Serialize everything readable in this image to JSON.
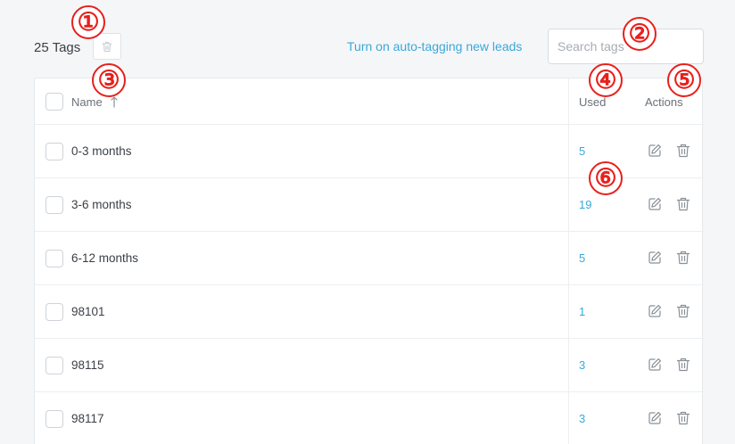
{
  "toolbar": {
    "tag_count": "25 Tags",
    "autotag_link": "Turn on auto-tagging new leads",
    "search_placeholder": "Search tags"
  },
  "table": {
    "headers": {
      "name": "Name",
      "used": "Used",
      "actions": "Actions"
    },
    "sort": {
      "column": "name",
      "direction": "ascending"
    },
    "rows": [
      {
        "name": "0-3 months",
        "used": "5"
      },
      {
        "name": "3-6 months",
        "used": "19"
      },
      {
        "name": "6-12 months",
        "used": "5"
      },
      {
        "name": "98101",
        "used": "1"
      },
      {
        "name": "98115",
        "used": "3"
      },
      {
        "name": "98117",
        "used": "3"
      }
    ]
  },
  "annotations": [
    "①",
    "②",
    "③",
    "④",
    "⑤",
    "⑥"
  ],
  "colors": {
    "link": "#3ba8d8",
    "marker": "#e8201c",
    "border": "#e6e9ec"
  },
  "icons": {
    "bulk_delete": "trash-icon",
    "edit": "edit-icon",
    "delete": "trash-icon",
    "sort": "arrow-up-icon"
  }
}
